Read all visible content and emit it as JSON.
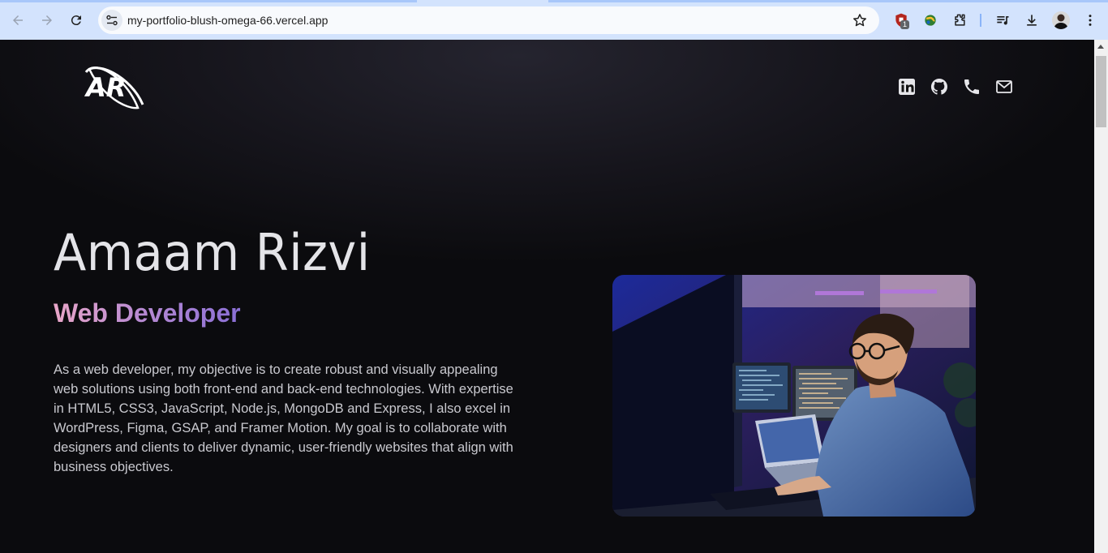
{
  "browser": {
    "url": "my-portfolio-blush-omega-66.vercel.app",
    "extension_badge": "1",
    "icons": [
      "back-icon",
      "forward-icon",
      "reload-icon",
      "site-info-icon",
      "bookmark-star-icon",
      "shield-extension-icon",
      "globe-extension-icon",
      "puzzle-extensions-icon",
      "media-controls-icon",
      "download-icon",
      "profile-avatar",
      "kebab-menu-icon"
    ]
  },
  "header": {
    "logo_text": "AR",
    "social_icons": [
      "linkedin-icon",
      "github-icon",
      "phone-icon",
      "mail-icon"
    ]
  },
  "hero": {
    "name": "Amaam Rizvi",
    "role": "Web Developer",
    "bio": "As a web developer, my objective is to create robust and visually appealing web solutions using both front-end and back-end technologies. With expertise in HTML5, CSS3, JavaScript, Node.js, MongoDB and Express, I also excel in WordPress, Figma, GSAP, and Framer Motion. My goal is to collaborate with designers and clients to deliver dynamic, user-friendly websites that align with business objectives."
  },
  "colors": {
    "background": "#0b0b0e",
    "role_gradient_start": "#e9a6c8",
    "role_gradient_end": "#8a6fd6",
    "chrome": "#d3e3fd"
  }
}
